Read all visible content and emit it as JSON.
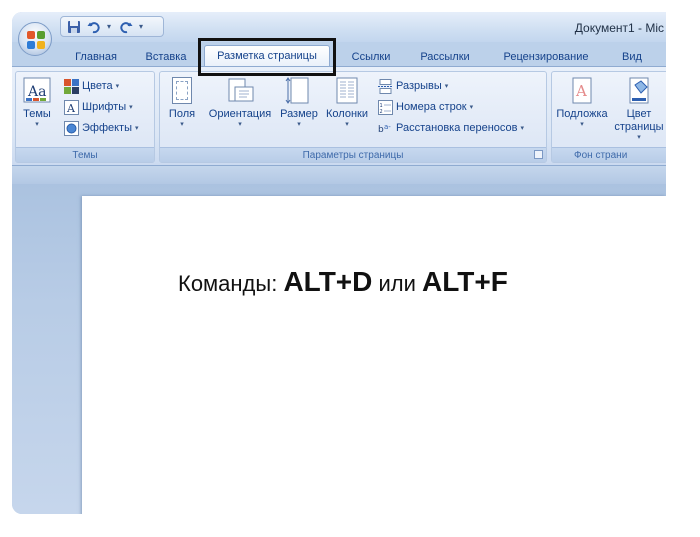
{
  "window": {
    "title": "Документ1 - Mic"
  },
  "tabs": [
    {
      "label": "Главная"
    },
    {
      "label": "Вставка"
    },
    {
      "label": "Разметка страницы",
      "active": true
    },
    {
      "label": "Ссылки"
    },
    {
      "label": "Рассылки"
    },
    {
      "label": "Рецензирование"
    },
    {
      "label": "Вид"
    }
  ],
  "ribbon": {
    "themes_group": {
      "label": "Темы",
      "themes_button": "Темы",
      "colors": "Цвета",
      "fonts": "Шрифты",
      "effects": "Эффекты"
    },
    "page_setup_group": {
      "label": "Параметры страницы",
      "margins": "Поля",
      "orientation": "Ориентация",
      "size": "Размер",
      "columns": "Колонки",
      "breaks": "Разрывы",
      "line_numbers": "Номера строк",
      "hyphenation": "Расстановка переносов"
    },
    "background_group": {
      "label": "Фон страни",
      "watermark": "Подложка",
      "page_color_line1": "Цвет",
      "page_color_line2": "страницы"
    }
  },
  "document": {
    "prefix": "Команды:",
    "key1": "ALT+D",
    "joiner": "или",
    "key2": "ALT+F"
  },
  "colors": {
    "ribbon_text": "#15428b",
    "highlight_box": "#111111",
    "office_logo": [
      "#e2582a",
      "#5a9e2f",
      "#2e7cd6",
      "#f0b21e"
    ]
  },
  "icons": {
    "office_button": "office-logo-icon",
    "save": "save-icon",
    "undo": "undo-icon",
    "redo": "redo-icon",
    "customize": "customize-qat-icon"
  }
}
